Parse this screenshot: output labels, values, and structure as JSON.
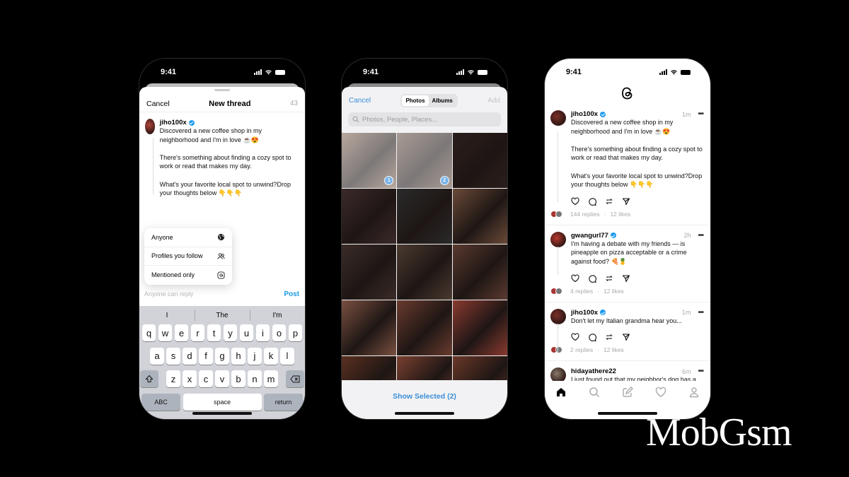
{
  "status_bar": {
    "time": "9:41"
  },
  "compose_screen": {
    "cancel": "Cancel",
    "title": "New thread",
    "char_count": "43",
    "author": "jiho100x",
    "paragraphs": [
      "Discovered a new coffee shop in my neighborhood and I'm in love ☕😍",
      "There's something about finding a cozy spot to work or read that makes my day.",
      "What's your favorite local spot to unwind?Drop your thoughts below 👇👇👇"
    ],
    "reply_menu": [
      {
        "label": "Anyone",
        "icon": "globe-icon"
      },
      {
        "label": "Profiles you follow",
        "icon": "people-icon"
      },
      {
        "label": "Mentioned only",
        "icon": "at-icon"
      }
    ],
    "reply_setting": "Anyone can reply",
    "post": "Post",
    "keyboard": {
      "suggestions": [
        "I",
        "The",
        "I'm"
      ],
      "row1": [
        "q",
        "w",
        "e",
        "r",
        "t",
        "y",
        "u",
        "i",
        "o",
        "p"
      ],
      "row2": [
        "a",
        "s",
        "d",
        "f",
        "g",
        "h",
        "j",
        "k",
        "l"
      ],
      "row3": [
        "z",
        "x",
        "c",
        "v",
        "b",
        "n",
        "m"
      ],
      "abc": "ABC",
      "space": "space",
      "return": "return"
    }
  },
  "photo_picker": {
    "cancel": "Cancel",
    "tabs": [
      "Photos",
      "Albums"
    ],
    "active_tab": "Photos",
    "add": "Add",
    "search_placeholder": "Photos, People, Places...",
    "selected_badges": [
      "1",
      "2"
    ],
    "show_selected": "Show Selected (2)",
    "tile_colors": [
      "#8a6b55",
      "#6d5446",
      "#2b1e1c",
      "#3b2a2a",
      "#2a2a2a",
      "#6a4a38",
      "#3a2c28",
      "#4a3a30",
      "#5a3a30",
      "#7a5040",
      "#6a3b2e",
      "#8a3a30",
      "#5a3020",
      "#7a4030",
      "#6a3828"
    ]
  },
  "feed_screen": {
    "posts": [
      {
        "author": "jiho100x",
        "time": "1m",
        "paragraphs": [
          "Discovered a new coffee shop in my neighborhood and I'm in love ☕😍",
          "There's something about finding a cozy spot to work or read that makes my day.",
          "What's your favorite local spot to unwind?Drop your thoughts below 👇👇👇"
        ],
        "replies": "144 replies",
        "likes": "12 likes"
      },
      {
        "author": "gwangurl77",
        "time": "2h",
        "paragraphs": [
          "I'm having a debate with my friends — is pineapple on pizza acceptable or a crime against food? 🍕🍍"
        ],
        "replies": "4 replies",
        "likes": "12 likes"
      },
      {
        "author": "jiho100x",
        "time": "1m",
        "paragraphs": [
          "Don't let my Italian grandma hear you..."
        ],
        "replies": "2 replies",
        "likes": "12 likes"
      },
      {
        "author": "hidayathere22",
        "time": "6m",
        "paragraphs": [
          "I just found out that my neighbor's dog has a"
        ]
      }
    ],
    "separator": "·",
    "tabs": [
      "home-icon",
      "search-icon",
      "compose-icon",
      "heart-icon",
      "profile-icon"
    ]
  },
  "watermark": "MobGsm",
  "colors": {
    "accent_blue": "#1a9be0",
    "verified": "#1d9bf0"
  }
}
